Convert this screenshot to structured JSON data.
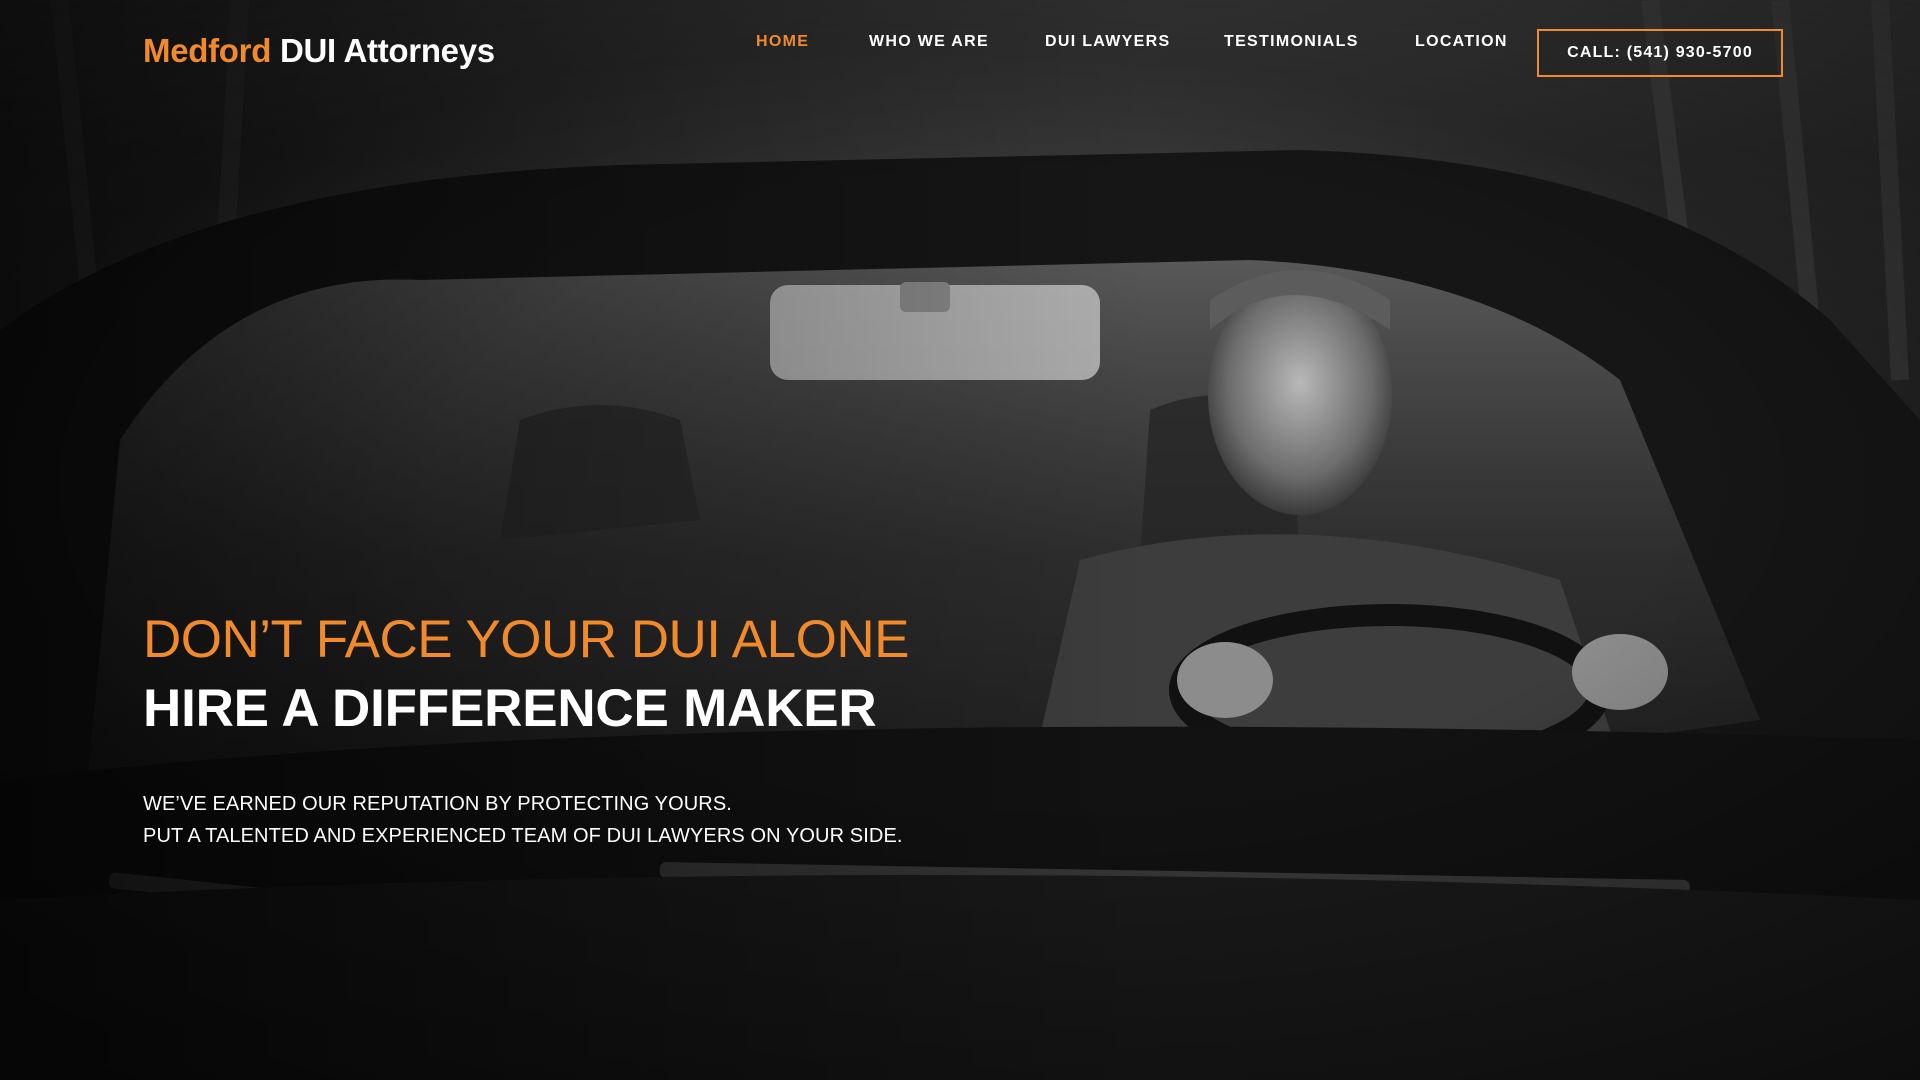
{
  "header": {
    "logo_accent": "Medford",
    "logo_rest": "DUI Attorneys",
    "nav": {
      "home": "HOME",
      "who_we_are": "WHO WE ARE",
      "dui_lawyers": "DUI LAWYERS",
      "testimonials": "TESTIMONIALS",
      "location": "LOCATION"
    },
    "call_button": "CALL: (541) 930-5700"
  },
  "hero": {
    "headline_primary": "DON’T FACE YOUR DUI ALONE",
    "headline_secondary": "HIRE A DIFFERENCE MAKER",
    "subline_1": "WE’VE EARNED OUR REPUTATION BY PROTECTING YOURS.",
    "subline_2": "PUT A TALENTED AND EXPERIENCED TEAM OF DUI LAWYERS ON YOUR SIDE."
  },
  "colors": {
    "accent": "#f08a2b",
    "text": "#ffffff",
    "background": "#1a1a1a"
  },
  "icons": {
    "hero_image": "man-driving-car-in-rain-photo"
  }
}
